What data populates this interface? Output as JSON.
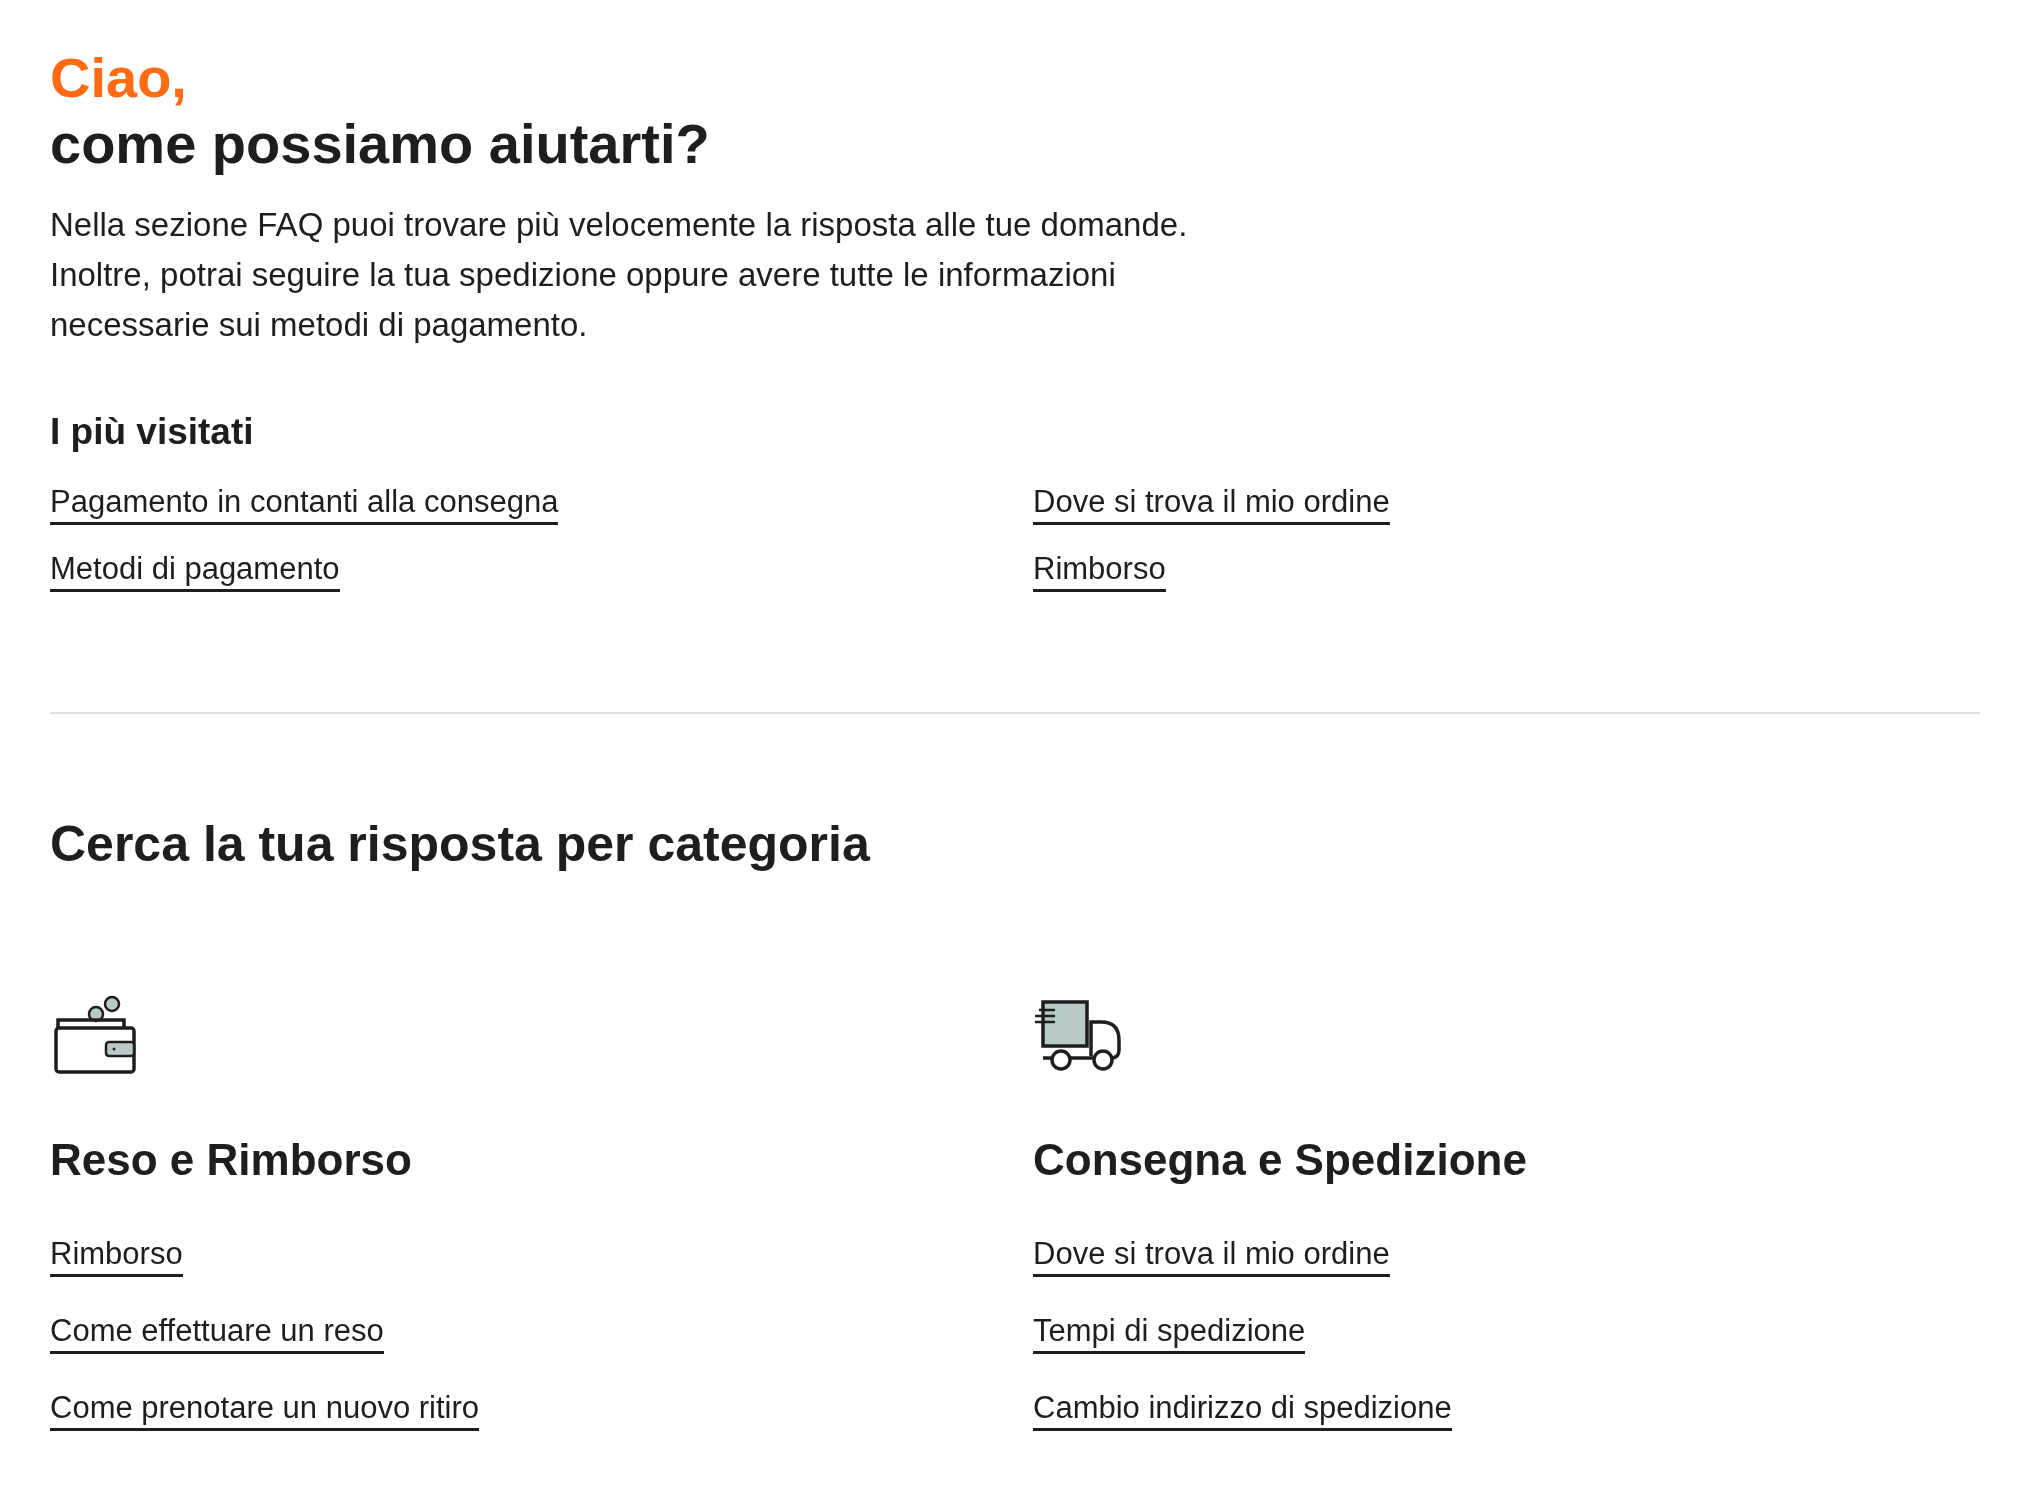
{
  "greeting": "Ciao,",
  "title": "come possiamo aiutarti?",
  "intro": [
    "Nella sezione FAQ puoi trovare più velocemente la risposta alle tue domande.",
    "Inoltre, potrai seguire la tua spedizione oppure avere tutte le informazioni",
    "necessarie sui metodi di pagamento."
  ],
  "most_visited": {
    "title": "I più visitati",
    "links": [
      "Pagamento in contanti alla consegna",
      "Dove si trova il mio ordine",
      "Metodi di pagamento",
      "Rimborso"
    ]
  },
  "categories_title": "Cerca la tua risposta per categoria",
  "categories": [
    {
      "kind": "wallet",
      "title": "Reso e Rimborso",
      "links": [
        "Rimborso",
        "Come effettuare un reso",
        "Come prenotare un nuovo ritiro"
      ]
    },
    {
      "kind": "truck",
      "title": "Consegna e Spedizione",
      "links": [
        "Dove si trova il mio ordine",
        "Tempi di spedizione",
        "Cambio indirizzo di spedizione"
      ]
    }
  ]
}
